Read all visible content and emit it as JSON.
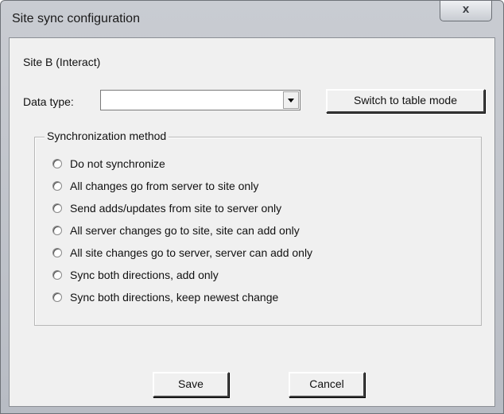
{
  "window": {
    "title": "Site sync configuration",
    "close_glyph": "x"
  },
  "site_label": "Site B (Interact)",
  "data_type": {
    "label": "Data type:",
    "value": ""
  },
  "switch_button_label": "Switch to table mode",
  "sync_group": {
    "title": "Synchronization method",
    "options": [
      "Do not synchronize",
      "All changes go from server to site only",
      "Send adds/updates from site to server only",
      "All server changes go to site, site can add only",
      "All site changes go to server, server can add only",
      "Sync both directions, add only",
      "Sync both directions, keep newest change"
    ]
  },
  "buttons": {
    "save": "Save",
    "cancel": "Cancel"
  }
}
